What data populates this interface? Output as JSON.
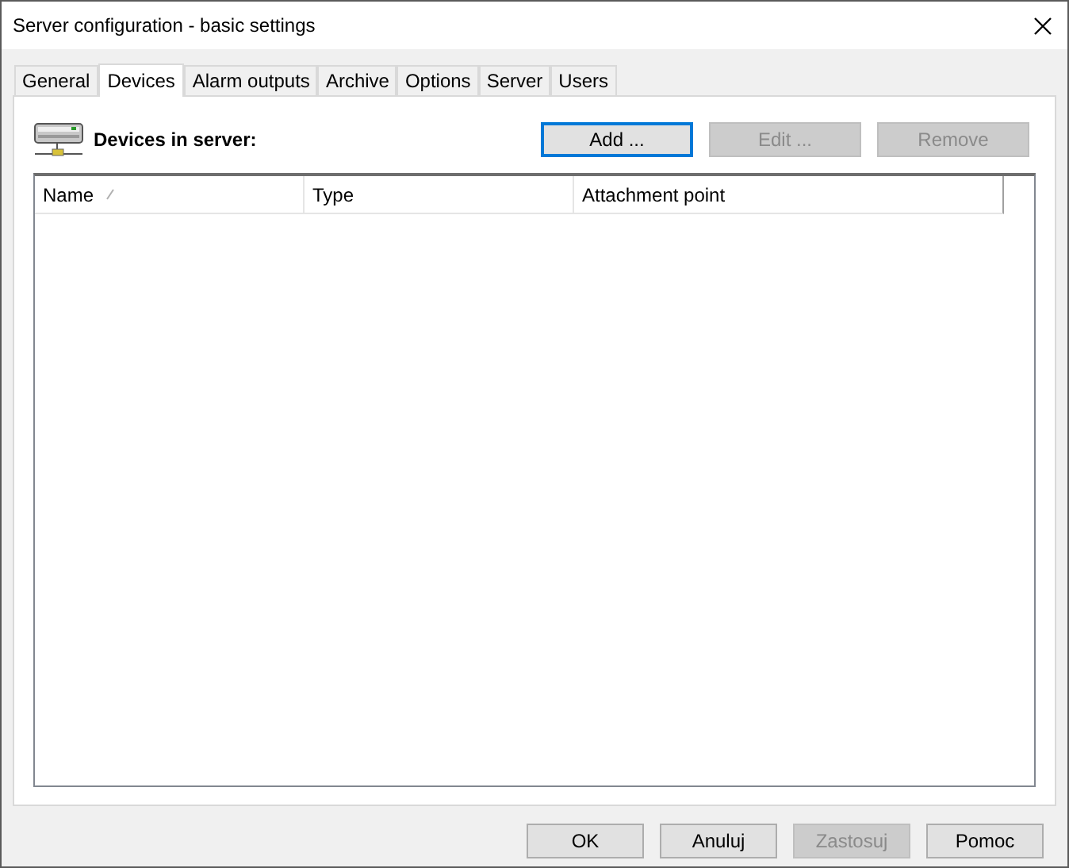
{
  "window": {
    "title": "Server configuration - basic settings"
  },
  "tabs": [
    {
      "label": "General",
      "selected": false
    },
    {
      "label": "Devices",
      "selected": true
    },
    {
      "label": "Alarm outputs",
      "selected": false
    },
    {
      "label": "Archive",
      "selected": false
    },
    {
      "label": "Options",
      "selected": false
    },
    {
      "label": "Server",
      "selected": false
    },
    {
      "label": "Users",
      "selected": false
    }
  ],
  "section": {
    "title": "Devices in server:"
  },
  "actions": [
    {
      "label": "Add ...",
      "disabled": false,
      "focused": true
    },
    {
      "label": "Edit ...",
      "disabled": true,
      "focused": false
    },
    {
      "label": "Remove",
      "disabled": true,
      "focused": false
    }
  ],
  "table": {
    "columns": [
      {
        "label": "Name",
        "sorted": true
      },
      {
        "label": "Type",
        "sorted": false
      },
      {
        "label": "Attachment point",
        "sorted": false
      }
    ]
  },
  "buttons": [
    {
      "label": "OK",
      "disabled": false
    },
    {
      "label": "Anuluj",
      "disabled": false
    },
    {
      "label": "Zastosuj",
      "disabled": true
    },
    {
      "label": "Pomoc",
      "disabled": false
    }
  ]
}
